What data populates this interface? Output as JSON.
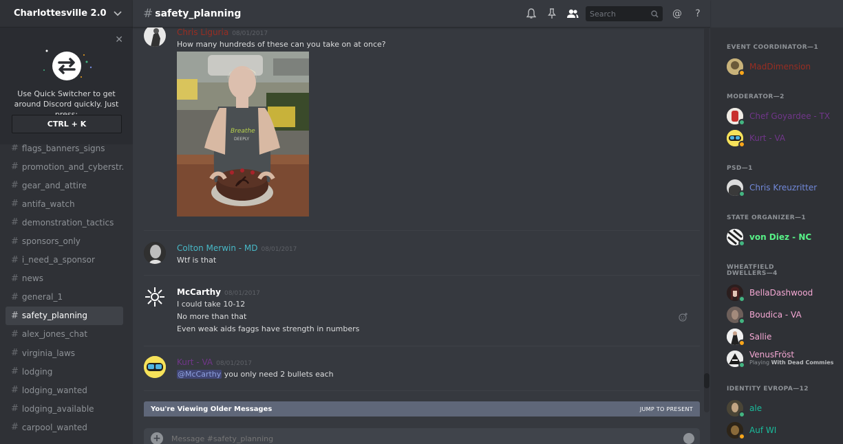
{
  "server": {
    "name": "Charlottesville 2.0"
  },
  "quick_switcher": {
    "text": "Use Quick Switcher to get around Discord quickly. Just press:",
    "shortcut": "CTRL + K"
  },
  "channels": [
    {
      "name": "flags_banners_signs"
    },
    {
      "name": "promotion_and_cyberstr..."
    },
    {
      "name": "gear_and_attire"
    },
    {
      "name": "antifa_watch"
    },
    {
      "name": "demonstration_tactics"
    },
    {
      "name": "sponsors_only"
    },
    {
      "name": "i_need_a_sponsor"
    },
    {
      "name": "news"
    },
    {
      "name": "general_1"
    },
    {
      "name": "safety_planning",
      "active": true
    },
    {
      "name": "alex_jones_chat"
    },
    {
      "name": "virginia_laws"
    },
    {
      "name": "lodging"
    },
    {
      "name": "lodging_wanted"
    },
    {
      "name": "lodging_available"
    },
    {
      "name": "carpool_wanted"
    }
  ],
  "header": {
    "channel": "safety_planning",
    "search_placeholder": "Search"
  },
  "messages": [
    {
      "author": "Chris Liguria",
      "color": "#992d22",
      "time": "08/01/2017",
      "lines": [
        "How many hundreds of these can you take on at once?"
      ],
      "has_image": true
    },
    {
      "author": "Colton Merwin - MD",
      "color": "#48b9c7",
      "time": "08/01/2017",
      "lines": [
        "Wtf is that"
      ]
    },
    {
      "author": "McCarthy",
      "color": "#ffffff",
      "time": "08/01/2017",
      "lines": [
        "I could take 10-12",
        "No more than that",
        "Even weak aids faggs have strength in numbers"
      ]
    },
    {
      "author": "Kurt - VA",
      "color": "#71368a",
      "time": "08/01/2017",
      "mention": "@McCarthy",
      "text": " you only need 2 bullets each"
    }
  ],
  "older_bar": {
    "text": "You're Viewing Older Messages",
    "jump": "JUMP TO PRESENT"
  },
  "composer": {
    "placeholder": "Message #safety_planning"
  },
  "member_groups": [
    {
      "role": "EVENT COORDINATOR—1",
      "members": [
        {
          "name": "MadDimension",
          "color": "#992d22",
          "status": "#faa61a"
        }
      ]
    },
    {
      "role": "MODERATOR—2",
      "members": [
        {
          "name": "Chef Goyardee - TX",
          "color": "#71368a",
          "status": "#43b581"
        },
        {
          "name": "Kurt - VA",
          "color": "#71368a",
          "status": "#faa61a"
        }
      ]
    },
    {
      "role": "PSD—1",
      "members": [
        {
          "name": "Chris Kreuzritter",
          "color": "#7289da",
          "status": "#43b581"
        }
      ]
    },
    {
      "role": "STATE ORGANIZER—1",
      "members": [
        {
          "name": "von Diez - NC",
          "color": "#57f287",
          "status": "#43b581"
        }
      ]
    },
    {
      "role": "WHEATFIELD DWELLERS—4",
      "members": [
        {
          "name": "BellaDashwood",
          "color": "#f5a8d4",
          "status": "#43b581"
        },
        {
          "name": "Boudica - VA",
          "color": "#f5a8d4",
          "status": "#43b581"
        },
        {
          "name": "Sallie",
          "color": "#f5a8d4",
          "status": "#faa61a"
        },
        {
          "name": "VenusFröst",
          "color": "#f5a8d4",
          "status": "#43b581",
          "activity_prefix": "Playing ",
          "activity": "With Dead Commies"
        }
      ]
    },
    {
      "role": "IDENTITY EVROPA—12",
      "members": [
        {
          "name": "ale",
          "color": "#1abc9c",
          "status": "#43b581"
        },
        {
          "name": "Auf WI",
          "color": "#1abc9c",
          "status": "#faa61a"
        }
      ]
    }
  ]
}
